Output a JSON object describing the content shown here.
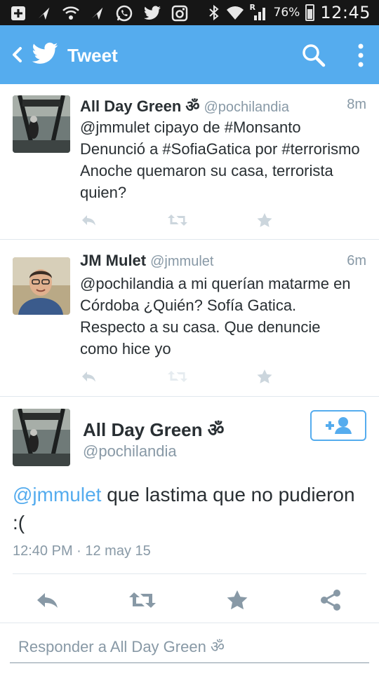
{
  "status_bar": {
    "battery_pct": "76%",
    "time": "12:45",
    "signal_label": "R"
  },
  "app_bar": {
    "title": "Tweet",
    "color": "#55acee"
  },
  "tweets": [
    {
      "name": "All Day Green ॐ",
      "handle": "@pochilandia",
      "time": "8m",
      "text": "@jmmulet cipayo de #Monsanto Denunció a #SofiaGatica por #terrorismo Anoche quemaron su casa, terrorista quien?"
    },
    {
      "name": "JM Mulet",
      "handle": "@jmmulet",
      "time": "6m",
      "text": "@pochilandia a mi querían matarme en Córdoba ¿Quién? Sofía Gatica. Respecto a su casa. Que denuncie como hice yo"
    }
  ],
  "focused_tweet": {
    "name": "All Day Green ॐ",
    "handle": "@pochilandia",
    "mention": "@jmmulet",
    "text": " que lastima que no pudieron :(",
    "timestamp": "12:40 PM · 12 may 15"
  },
  "reply": {
    "placeholder": "Responder a All Day Green ॐ"
  },
  "colors": {
    "accent": "#55acee",
    "secondary_text": "#8899a6",
    "icon_gray": "#ccd6dd",
    "action_dark": "#8899a6"
  }
}
